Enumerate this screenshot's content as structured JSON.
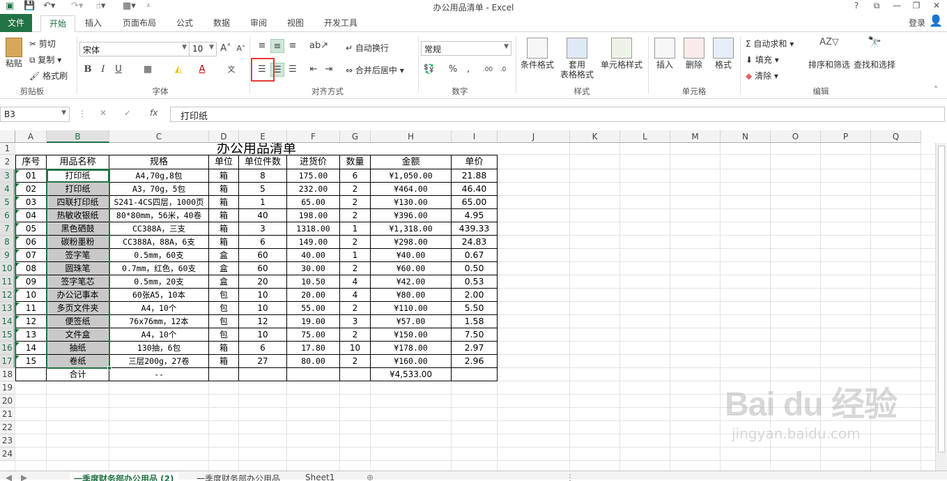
{
  "app": {
    "title": "办公用品清单 - Excel",
    "login": "登录"
  },
  "window_buttons": [
    "?",
    "⧉",
    "—",
    "❐",
    "✕"
  ],
  "tabs": [
    "文件",
    "开始",
    "插入",
    "页面布局",
    "公式",
    "数据",
    "审阅",
    "视图",
    "开发工具"
  ],
  "ribbon": {
    "clipboard": {
      "label": "剪贴板",
      "paste": "粘贴",
      "cut": "剪切",
      "copy": "复制",
      "format_painter": "格式刷"
    },
    "font": {
      "label": "字体",
      "name": "宋体",
      "size": "10"
    },
    "alignment": {
      "label": "对齐方式",
      "wrap": "自动换行",
      "merge": "合并后居中"
    },
    "number": {
      "label": "数字",
      "format": "常规"
    },
    "styles": {
      "label": "样式",
      "conditional": "条件格式",
      "table1": "套用",
      "table2": "表格格式",
      "cell_styles": "单元格样式"
    },
    "cells": {
      "label": "单元格",
      "insert": "插入",
      "delete": "删除",
      "format": "格式"
    },
    "editing": {
      "label": "编辑",
      "autosum": "自动求和",
      "fill": "填充",
      "clear": "清除",
      "sort": "排序和筛选",
      "find": "查找和选择"
    }
  },
  "formula_bar": {
    "name_box": "B3",
    "formula": "打印纸",
    "fx": "fx"
  },
  "columns": [
    "A",
    "B",
    "C",
    "D",
    "E",
    "F",
    "G",
    "H",
    "I",
    "J",
    "K",
    "L",
    "M",
    "N",
    "O",
    "P",
    "Q"
  ],
  "rows": [
    "1",
    "2",
    "3",
    "4",
    "5",
    "6",
    "7",
    "8",
    "9",
    "10",
    "11",
    "12",
    "13",
    "14",
    "15",
    "16",
    "17",
    "18",
    "19",
    "20",
    "21",
    "22",
    "23",
    "24"
  ],
  "sheet": {
    "title": "办公用品清单",
    "headers": [
      "序号",
      "用品名称",
      "规格",
      "单位",
      "单位件数",
      "进货价",
      "数量",
      "金额",
      "单价"
    ],
    "data": [
      [
        "01",
        "打印纸",
        "A4,70g,8包",
        "箱",
        "8",
        "175.00",
        "6",
        "¥1,050.00",
        "21.88"
      ],
      [
        "02",
        "打印纸",
        "A3，70g，5包",
        "箱",
        "5",
        "232.00",
        "2",
        "¥464.00",
        "46.40"
      ],
      [
        "03",
        "四联打印纸",
        "S241-4CS四层，1000页",
        "箱",
        "1",
        "65.00",
        "2",
        "¥130.00",
        "65.00"
      ],
      [
        "04",
        "热敏收银纸",
        "80*80mm，56米，40卷",
        "箱",
        "40",
        "198.00",
        "2",
        "¥396.00",
        "4.95"
      ],
      [
        "05",
        "黑色硒鼓",
        "CC388A，三支",
        "箱",
        "3",
        "1318.00",
        "1",
        "¥1,318.00",
        "439.33"
      ],
      [
        "06",
        "碳粉墨粉",
        "CC388A，88A，6支",
        "箱",
        "6",
        "149.00",
        "2",
        "¥298.00",
        "24.83"
      ],
      [
        "07",
        "签字笔",
        "0.5mm，60支",
        "盒",
        "60",
        "40.00",
        "1",
        "¥40.00",
        "0.67"
      ],
      [
        "08",
        "圆珠笔",
        "0.7mm，红色，60支",
        "盒",
        "60",
        "30.00",
        "2",
        "¥60.00",
        "0.50"
      ],
      [
        "09",
        "签字笔芯",
        "0.5mm，20支",
        "盒",
        "20",
        "10.50",
        "4",
        "¥42.00",
        "0.53"
      ],
      [
        "10",
        "办公记事本",
        "60张A5，10本",
        "包",
        "10",
        "20.00",
        "4",
        "¥80.00",
        "2.00"
      ],
      [
        "11",
        "多页文件夹",
        "A4，10个",
        "包",
        "10",
        "55.00",
        "2",
        "¥110.00",
        "5.50"
      ],
      [
        "12",
        "便签纸",
        "76x76mm，12本",
        "包",
        "12",
        "19.00",
        "3",
        "¥57.00",
        "1.58"
      ],
      [
        "13",
        "文件盒",
        "A4，10个",
        "包",
        "10",
        "75.00",
        "2",
        "¥150.00",
        "7.50"
      ],
      [
        "14",
        "抽纸",
        "130抽，6包",
        "箱",
        "6",
        "17.80",
        "10",
        "¥178.00",
        "2.97"
      ],
      [
        "15",
        "卷纸",
        "三层200g，27卷",
        "箱",
        "27",
        "80.00",
        "2",
        "¥160.00",
        "2.96"
      ]
    ],
    "total": {
      "label": "合计",
      "spec": "--",
      "amount": "¥4,533.00"
    }
  },
  "sheet_tabs": [
    "一季度财务部办公用品 (2)",
    "一季度财务部办公用品",
    "Sheet1"
  ],
  "watermark": {
    "brand": "Bai du 经验",
    "url": "jingyan.baidu.com"
  }
}
